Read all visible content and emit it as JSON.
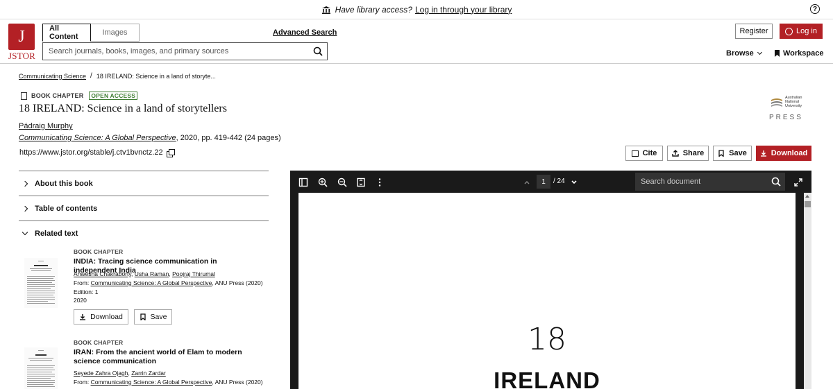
{
  "banner": {
    "prefix": "Have library access?",
    "link": "Log in through your library"
  },
  "header": {
    "logo_text": "JSTOR",
    "tabs": [
      "All Content",
      "Images"
    ],
    "advanced_search": "Advanced Search",
    "search_placeholder": "Search journals, books, images, and primary sources",
    "register": "Register",
    "login": "Log in",
    "browse": "Browse",
    "workspace": "Workspace"
  },
  "breadcrumb": {
    "parent": "Communicating Science",
    "current": "18 IRELAND: Science in a land of storyte..."
  },
  "item": {
    "type": "BOOK CHAPTER",
    "badge": "OPEN ACCESS",
    "title": "18 IRELAND: Science in a land of storytellers",
    "author": "Pádraig Murphy",
    "book": "Communicating Science: A Global Perspective",
    "source_rest": ", 2020, pp. 419-442 (24 pages)",
    "stable_url": "https://www.jstor.org/stable/j.ctv1bvnctz.22"
  },
  "publisher": {
    "lines": [
      "Australian",
      "National",
      "University"
    ],
    "press": "PRESS"
  },
  "actions": {
    "cite": "Cite",
    "share": "Share",
    "save": "Save",
    "download": "Download"
  },
  "accordion": {
    "about": "About this book",
    "toc": "Table of contents",
    "related": "Related text"
  },
  "related": [
    {
      "type": "BOOK CHAPTER",
      "title": "INDIA: Tracing science communication in independent India",
      "authors": [
        "Anwesha Chakraborty",
        "Usha Raman",
        "Poojraj Thirumal"
      ],
      "from_label": "From: ",
      "from_book": "Communicating Science: A Global Perspective",
      "from_rest": ", ANU Press (2020)",
      "edition": "Edition: 1",
      "year": "2020",
      "download": "Download",
      "save": "Save"
    },
    {
      "type": "BOOK CHAPTER",
      "title": "IRAN: From the ancient world of Elam to modern science communication",
      "authors": [
        "Seyede Zahra Ojagh",
        "Zarrin Zardar"
      ],
      "from_label": "From: ",
      "from_book": "Communicating Science: A Global Perspective",
      "from_rest": ", ANU Press (2020)"
    }
  ],
  "viewer": {
    "page_current": "1",
    "page_total": "/ 24",
    "search_placeholder": "Search document",
    "page_number": "18",
    "page_heading": "IRELAND"
  },
  "colors": {
    "brand_red": "#b32025",
    "open_access_green": "#3e7d32",
    "viewer_bg": "#1a1a1a"
  }
}
